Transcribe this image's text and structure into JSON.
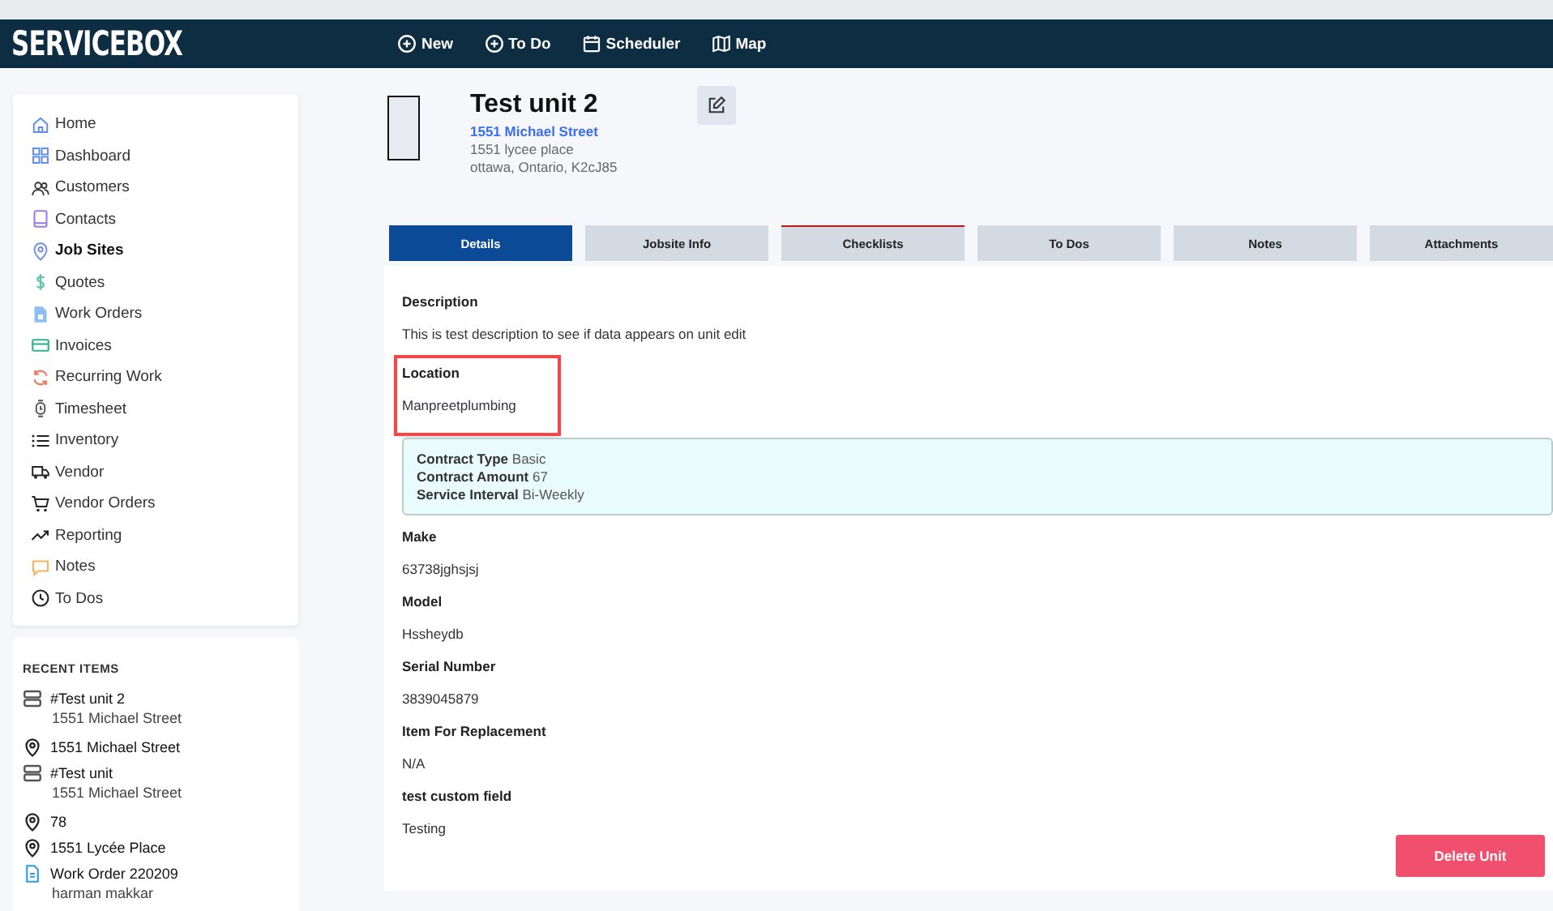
{
  "navbar": {
    "logo": "SERVICEBOX",
    "actions": [
      {
        "kind": "add",
        "label": "New"
      },
      {
        "kind": "add",
        "label": "To Do"
      },
      {
        "kind": "calendar",
        "label": "Scheduler"
      },
      {
        "kind": "map",
        "label": "Map"
      }
    ]
  },
  "sidebar": {
    "items": [
      {
        "label": "Home",
        "selected": false
      },
      {
        "label": "Dashboard",
        "selected": false
      },
      {
        "label": "Customers",
        "selected": false
      },
      {
        "label": "Contacts",
        "selected": false
      },
      {
        "label": "Job Sites",
        "selected": true
      },
      {
        "label": "Quotes",
        "selected": false
      },
      {
        "label": "Work Orders",
        "selected": false
      },
      {
        "label": "Invoices",
        "selected": false
      },
      {
        "label": "Recurring Work",
        "selected": false
      },
      {
        "label": "Timesheet",
        "selected": false
      },
      {
        "label": "Inventory",
        "selected": false
      },
      {
        "label": "Vendor",
        "selected": false
      },
      {
        "label": "Vendor Orders",
        "selected": false
      },
      {
        "label": "Reporting",
        "selected": false
      },
      {
        "label": "Notes",
        "selected": false
      },
      {
        "label": "To Dos",
        "selected": false
      }
    ]
  },
  "recent_items": {
    "title": "RECENT ITEMS",
    "items": [
      {
        "kind": "unit",
        "title": "#Test unit 2",
        "subtitle": "1551 Michael Street"
      },
      {
        "kind": "site",
        "title": "1551 Michael Street"
      },
      {
        "kind": "unit",
        "title": "#Test unit",
        "subtitle": "1551 Michael Street"
      },
      {
        "kind": "site",
        "title": "78"
      },
      {
        "kind": "site",
        "title": "1551 Lycée Place"
      },
      {
        "kind": "order",
        "title": "Work Order 220209",
        "subtitle": "harman makkar"
      }
    ]
  },
  "unit": {
    "title": "Test unit 2",
    "site": "1551 Michael Street",
    "address_line": "1551 lycee place",
    "city_line": "ottawa, Ontario, K2cJ85"
  },
  "tabs": [
    {
      "label": "Details",
      "selected": true,
      "flagged": false
    },
    {
      "label": "Jobsite Info",
      "selected": false,
      "flagged": false
    },
    {
      "label": "Checklists",
      "selected": false,
      "flagged": true
    },
    {
      "label": "To Dos",
      "selected": false,
      "flagged": false
    },
    {
      "label": "Notes",
      "selected": false,
      "flagged": false
    },
    {
      "label": "Attachments",
      "selected": false,
      "flagged": false
    }
  ],
  "details": [
    {
      "kind": "field",
      "label": "Description",
      "value": "This is test description to see if data appears on unit edit",
      "highlighted": false
    },
    {
      "kind": "field",
      "label": "Location",
      "value": "Manpreetplumbing",
      "highlighted": true
    },
    {
      "kind": "contract",
      "rows": [
        {
          "label": "Contract Type",
          "value": "Basic"
        },
        {
          "label": "Contract Amount",
          "value": "67"
        },
        {
          "label": "Service Interval",
          "value": "Bi-Weekly"
        }
      ]
    },
    {
      "kind": "field",
      "label": "Make",
      "value": "63738jghsjsj",
      "highlighted": false
    },
    {
      "kind": "field",
      "label": "Model",
      "value": "Hssheydb",
      "highlighted": false
    },
    {
      "kind": "field",
      "label": "Serial Number",
      "value": "3839045879",
      "highlighted": false
    },
    {
      "kind": "field",
      "label": "Item For Replacement",
      "value": "N/A",
      "highlighted": false
    },
    {
      "kind": "field",
      "label": "test custom field",
      "value": "Testing",
      "highlighted": false
    }
  ],
  "delete_button": "Delete Unit"
}
